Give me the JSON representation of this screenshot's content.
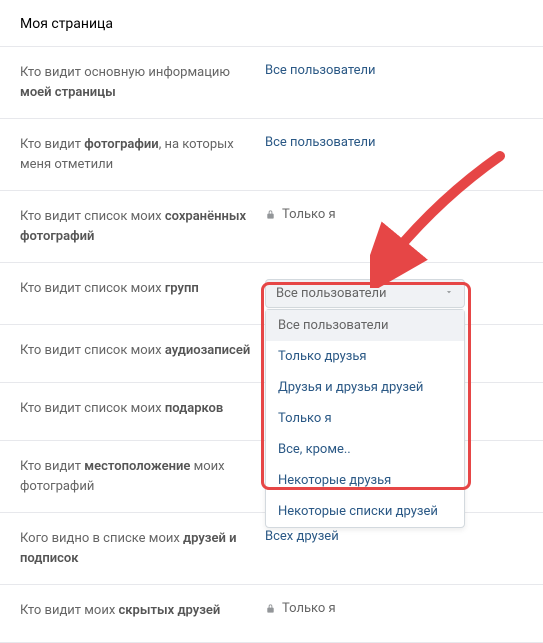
{
  "header": {
    "title": "Моя страница"
  },
  "rows": [
    {
      "label_pre": "Кто видит основную информацию ",
      "label_bold": "моей страницы",
      "label_post": "",
      "type": "link",
      "value": "Все пользователи"
    },
    {
      "label_pre": "Кто видит ",
      "label_bold": "фотографии",
      "label_post": ", на которых меня отметили",
      "type": "link",
      "value": "Все пользователи"
    },
    {
      "label_pre": "Кто видит список моих ",
      "label_bold": "сохранённых фотографий",
      "label_post": "",
      "type": "lock",
      "value": "Только я"
    },
    {
      "label_pre": "Кто видит список моих ",
      "label_bold": "групп",
      "label_post": "",
      "type": "dropdown",
      "value": "Все пользователи"
    },
    {
      "label_pre": "Кто видит список моих ",
      "label_bold": "аудиозаписей",
      "label_post": "",
      "type": "none",
      "value": ""
    },
    {
      "label_pre": "Кто видит список моих ",
      "label_bold": "подарков",
      "label_post": "",
      "type": "none",
      "value": ""
    },
    {
      "label_pre": "Кто видит ",
      "label_bold": "местоположение",
      "label_post": " моих фотографий",
      "type": "none",
      "value": ""
    },
    {
      "label_pre": "Кого видно в списке моих ",
      "label_bold": "друзей и подписок",
      "label_post": "",
      "type": "link",
      "value": "Всех друзей"
    },
    {
      "label_pre": "Кто видит моих ",
      "label_bold": "скрытых друзей",
      "label_post": "",
      "type": "lock",
      "value": "Только я"
    }
  ],
  "dropdown_options": [
    "Все пользователи",
    "Только друзья",
    "Друзья и друзья друзей",
    "Только я",
    "Все, кроме..",
    "Некоторые друзья",
    "Некоторые списки друзей"
  ]
}
